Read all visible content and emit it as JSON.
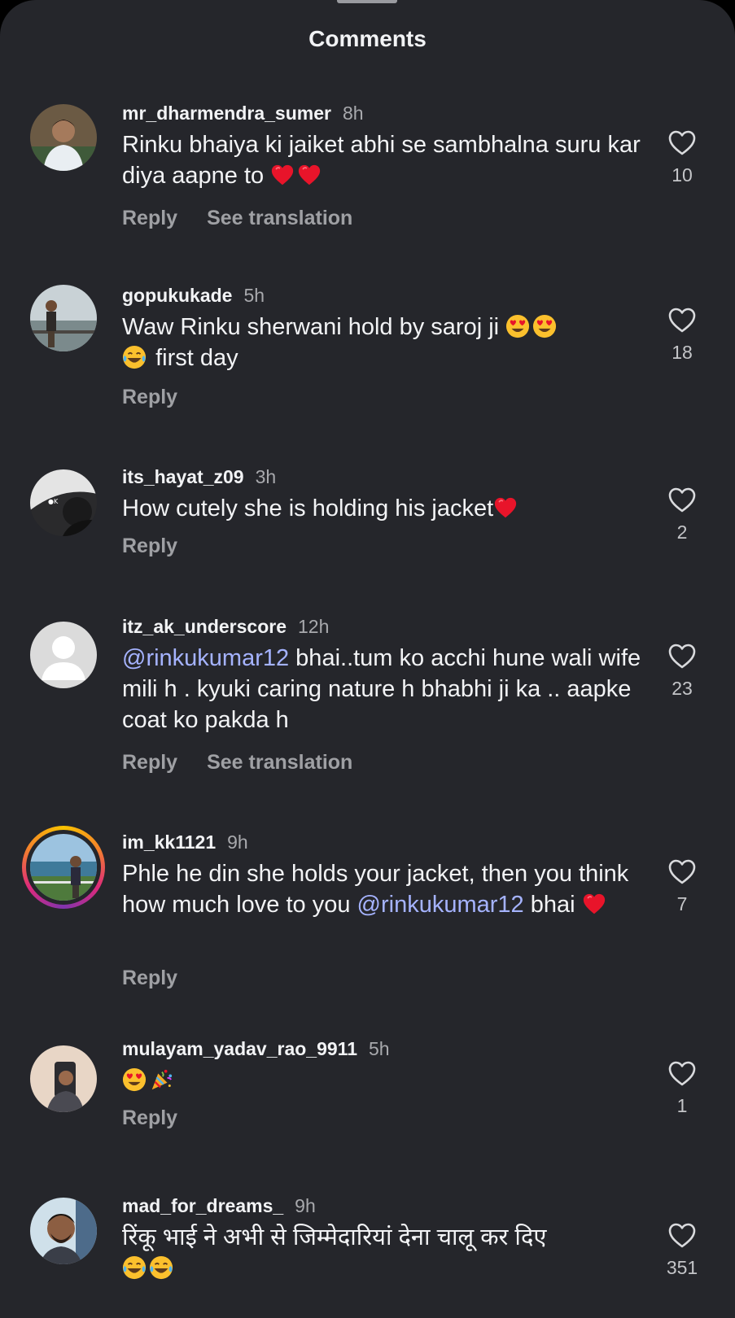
{
  "header": {
    "title": "Comments"
  },
  "comments": [
    {
      "username": "mr_dharmendra_sumer",
      "time": "8h",
      "text": "Rinku bhaiya ki jaiket abhi se sambhalna suru kar diya aapne to",
      "likes": "10",
      "reply": "Reply",
      "translate": "See translation"
    },
    {
      "username": "gopukukade",
      "time": "5h",
      "text": "Waw Rinku sherwani hold by saroj ji",
      "text2": "first day",
      "likes": "18",
      "reply": "Reply"
    },
    {
      "username": "its_hayat_z09",
      "time": "3h",
      "text": "How cutely she is holding his jacket",
      "likes": "2",
      "reply": "Reply"
    },
    {
      "username": "itz_ak_underscore",
      "time": "12h",
      "mention": "@rinkukumar12",
      "text": " bhai..tum ko acchi hune wali wife mili h . kyuki caring nature h bhabhi ji ka .. aapke coat ko pakda h",
      "likes": "23",
      "reply": "Reply",
      "translate": "See translation"
    },
    {
      "username": "im_kk1121",
      "time": "9h",
      "text": "Phle he din she holds your jacket, then you think how much love to you ",
      "mention": "@rinkukumar12",
      "text2": " bhai",
      "likes": "7",
      "reply": "Reply"
    },
    {
      "username": "mulayam_yadav_rao_9911",
      "time": "5h",
      "likes": "1",
      "reply": "Reply"
    },
    {
      "username": "mad_for_dreams_",
      "time": "9h",
      "text": "रिंकू भाई ने अभी से जिम्मेदारियां देना चालू कर दिए",
      "likes": "351"
    }
  ],
  "icons": {
    "like": "heart-outline-icon",
    "heart_emoji": "red-heart-emoji",
    "heart_eyes": "heart-eyes-emoji",
    "laughing": "tears-of-joy-emoji",
    "party": "party-popper-emoji"
  },
  "colors": {
    "background": "#25262b",
    "text": "#f2f3f5",
    "secondary": "#9fa0a4",
    "mention": "#a5b3ff",
    "heart_red": "#e8142a"
  }
}
